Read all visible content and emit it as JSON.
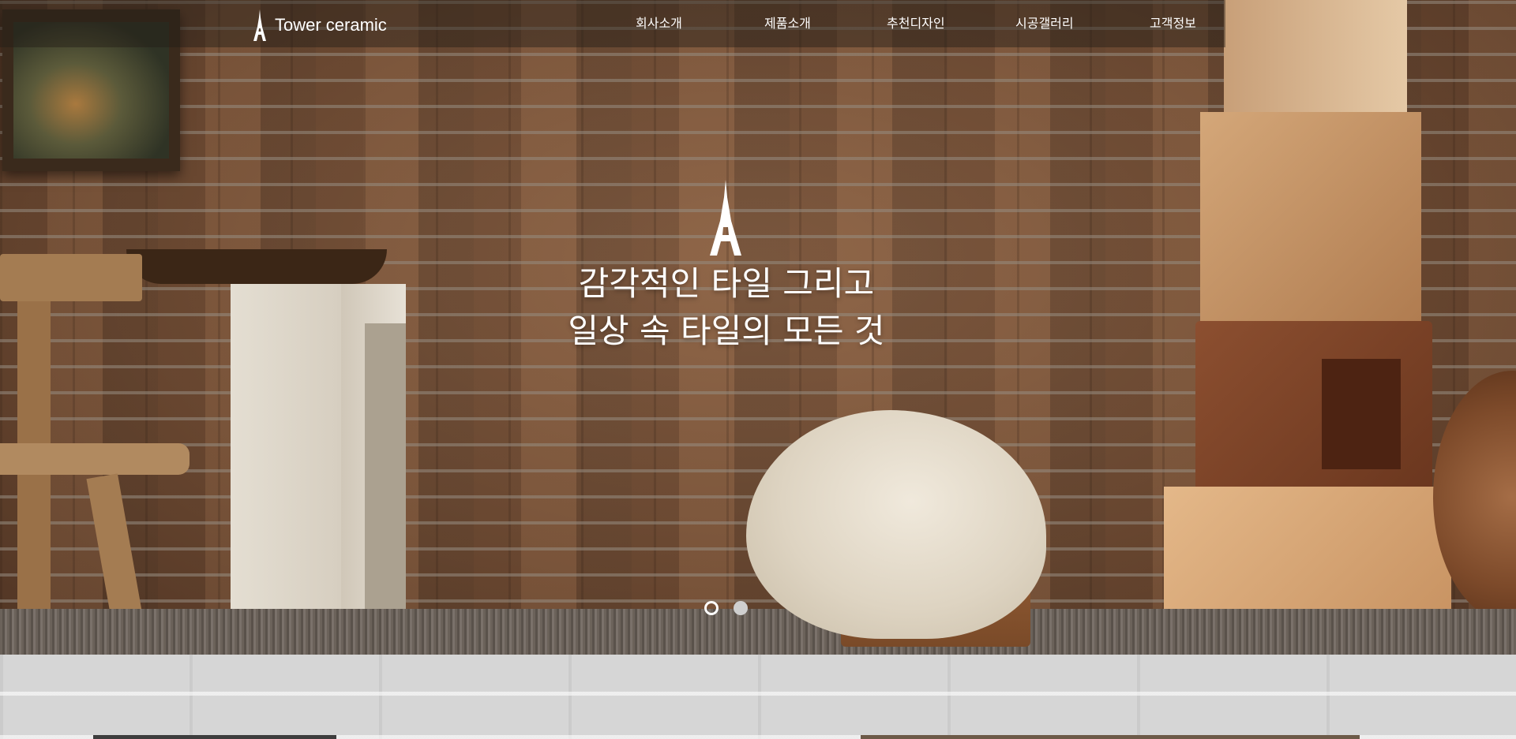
{
  "brand": {
    "name": "Tower ceramic"
  },
  "nav": {
    "items": [
      "회사소개",
      "제품소개",
      "추천디자인",
      "시공갤러리",
      "고객정보"
    ]
  },
  "hero": {
    "headline_line1": "감각적인 타일 그리고",
    "headline_line2": "일상 속 타일의 모든 것"
  },
  "slider": {
    "current": 1,
    "total": 2
  },
  "colors": {
    "nav_text": "#ffffff",
    "lower_bg": "#d6d6d6"
  },
  "icons": {
    "logo": "eiffel-tower-icon"
  }
}
